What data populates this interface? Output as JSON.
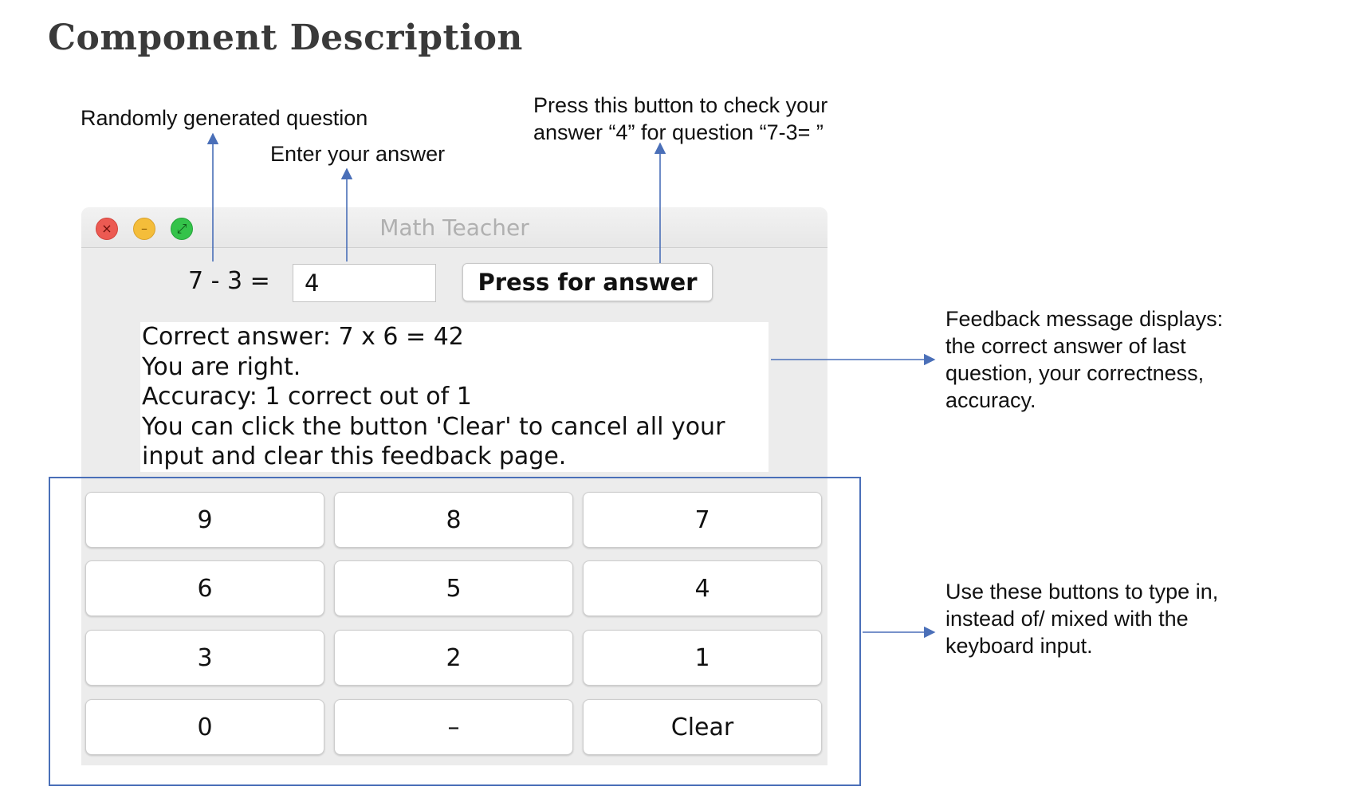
{
  "heading": "Component Description",
  "annotations": {
    "question": "Randomly generated question",
    "answer": "Enter your answer",
    "press": "Press this button to check your\nanswer “4” for question “7-3= ”",
    "feedback": "Feedback message displays:\nthe correct answer of last\nquestion, your correctness,\naccuracy.",
    "keypad": "Use these buttons to type in,\ninstead of/ mixed with the\nkeyboard input."
  },
  "window": {
    "title": "Math Teacher",
    "question": "7 - 3 =",
    "answer_value": "4",
    "press_label": "Press for answer",
    "feedback_lines": [
      "Correct answer: 7 x 6 = 42",
      "You are right.",
      "Accuracy: 1 correct out of 1",
      "You can click the button 'Clear' to cancel all your",
      "input and clear this feedback page."
    ],
    "keys": [
      "9",
      "8",
      "7",
      "6",
      "5",
      "4",
      "3",
      "2",
      "1",
      "0",
      "–",
      "Clear"
    ]
  },
  "colors": {
    "arrow": "#4a6fb8",
    "window_bg": "#ececec",
    "close": "#ec5a52",
    "minimize": "#f4bd3a",
    "zoom": "#34c34a"
  },
  "icons": [
    "close-icon",
    "minimize-icon",
    "zoom-icon"
  ]
}
